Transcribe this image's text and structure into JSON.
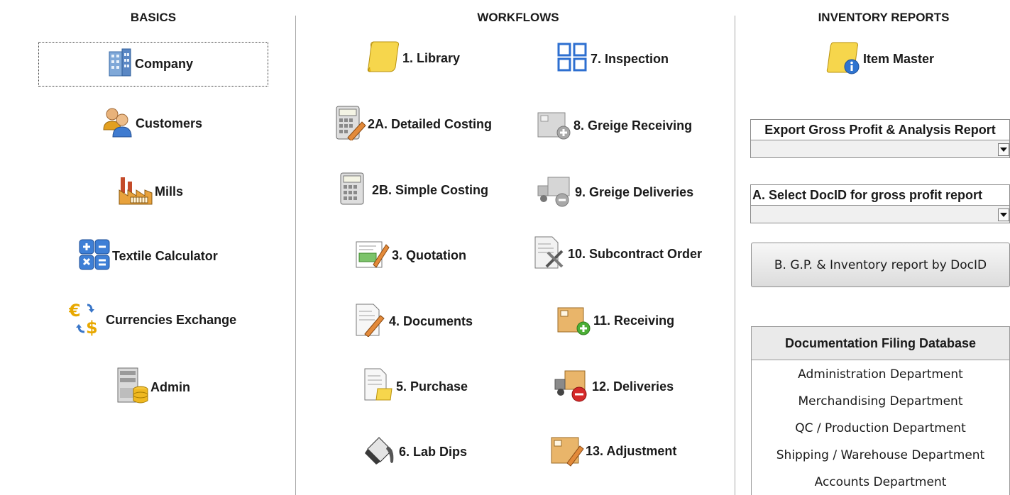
{
  "headers": {
    "basics": "BASICS",
    "workflows": "WORKFLOWS",
    "inventory": "INVENTORY REPORTS"
  },
  "basics": {
    "company": "Company",
    "customers": "Customers",
    "mills": "Mills",
    "textile_calculator": "Textile Calculator",
    "currencies_exchange": "Currencies Exchange",
    "admin": "Admin"
  },
  "workflows": {
    "library": "1. Library",
    "detailed_costing": "2A. Detailed Costing",
    "simple_costing": "2B. Simple Costing",
    "quotation": "3. Quotation",
    "documents": "4. Documents",
    "purchase": "5. Purchase",
    "lab_dips": "6. Lab Dips",
    "inspection": "7. Inspection",
    "greige_receiving": "8. Greige Receiving",
    "greige_deliveries": "9. Greige Deliveries",
    "subcontract_order": "10. Subcontract Order",
    "receiving": "11. Receiving",
    "deliveries": "12. Deliveries",
    "adjustment": "13. Adjustment"
  },
  "inventory": {
    "item_master": "Item Master",
    "export_gp_label": "Export Gross Profit & Analysis Report",
    "export_gp_value": "",
    "select_docid_label": "A. Select DocID for gross profit report",
    "select_docid_value": "",
    "gp_report_button": "B. G.P. & Inventory report by DocID"
  },
  "documentation": {
    "title": "Documentation Filing Database",
    "departments": [
      "Administration Department",
      "Merchandising Department",
      "QC / Production Department",
      "Shipping / Warehouse Department",
      "Accounts Department"
    ]
  },
  "icons": {
    "company": "building-icon",
    "customers": "users-icon",
    "mills": "factory-icon",
    "textile_calculator": "calculator-icon",
    "currencies_exchange": "currency-exchange-icon",
    "admin": "server-database-icon",
    "library": "scroll-icon",
    "inspection": "grid-icon"
  }
}
